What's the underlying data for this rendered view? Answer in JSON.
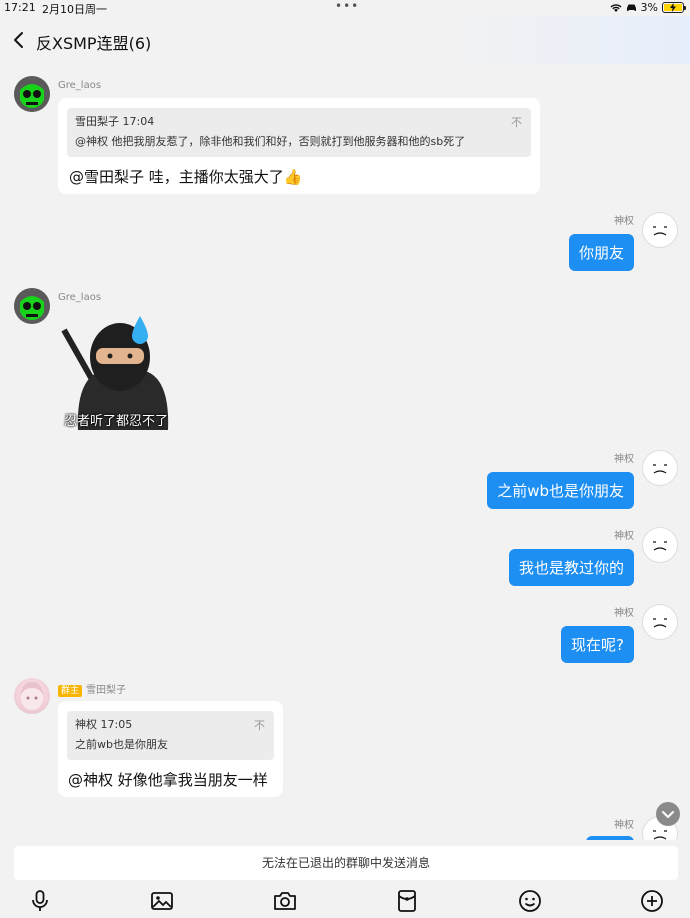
{
  "status": {
    "time": "17:21",
    "date": "2月10日周一",
    "battery": "3%"
  },
  "header": {
    "title": "反XSMP连盟(6)"
  },
  "messages": {
    "m1": {
      "sender": "Gre_laos",
      "quote_head": "雪田梨子 17:04",
      "quote_text": "@神权 他把我朋友惹了，除非他和我们和好，否则就打到他服务器和他的sb死了",
      "pin": "不",
      "text": "@雪田梨子 哇，主播你太强大了👍"
    },
    "m2": {
      "sender": "神权",
      "text": "你朋友"
    },
    "m3": {
      "sender": "Gre_laos",
      "caption": "忍者听了都忍不了"
    },
    "m4": {
      "sender": "神权",
      "text": "之前wb也是你朋友"
    },
    "m5": {
      "sender": "神权",
      "text": "我也是教过你的"
    },
    "m6": {
      "sender": "神权",
      "text": "现在呢?"
    },
    "m7": {
      "badge": "群主",
      "sender": "雪田梨子",
      "quote_head": "神权 17:05",
      "quote_text": "之前wb也是你朋友",
      "pin": "不",
      "text": "@神权 好像他拿我当朋友一样"
    },
    "m8": {
      "sender": "神权"
    }
  },
  "notice": "无法在已退出的群聊中发送消息",
  "toolbar": [
    "microphone-icon",
    "image-icon",
    "camera-icon",
    "red-packet-icon",
    "emoji-icon",
    "plus-icon"
  ]
}
